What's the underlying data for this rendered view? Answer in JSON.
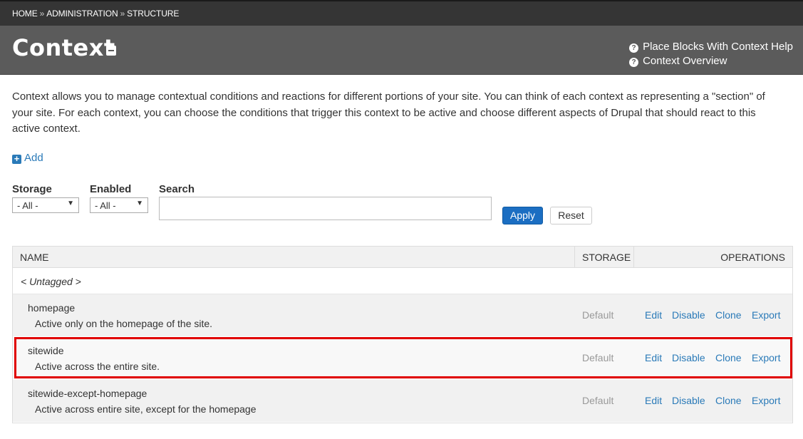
{
  "breadcrumb": {
    "items": [
      "HOME",
      "ADMINISTRATION",
      "STRUCTURE"
    ],
    "separator": "»"
  },
  "header": {
    "title": "Context",
    "help_links": [
      "Place Blocks With Context Help",
      "Context Overview"
    ]
  },
  "intro_text": "Context allows you to manage contextual conditions and reactions for different portions of your site. You can think of each context as representing a \"section\" of your site. For each context, you can choose the conditions that trigger this context to be active and choose different aspects of Drupal that should react to this active context.",
  "add_label": "Add",
  "filters": {
    "storage_label": "Storage",
    "storage_value": "- All -",
    "enabled_label": "Enabled",
    "enabled_value": "- All -",
    "search_label": "Search",
    "search_value": "",
    "apply_label": "Apply",
    "reset_label": "Reset"
  },
  "table": {
    "headers": {
      "name": "NAME",
      "storage": "STORAGE",
      "operations": "OPERATIONS"
    },
    "group_label": "< Untagged >",
    "rows": [
      {
        "name": "homepage",
        "description": "Active only on the homepage of the site.",
        "storage": "Default",
        "ops": [
          "Edit",
          "Disable",
          "Clone",
          "Export"
        ]
      },
      {
        "name": "sitewide",
        "description": "Active across the entire site.",
        "storage": "Default",
        "ops": [
          "Edit",
          "Disable",
          "Clone",
          "Export"
        ]
      },
      {
        "name": "sitewide-except-homepage",
        "description": "Active across entire site, except for the homepage",
        "storage": "Default",
        "ops": [
          "Edit",
          "Disable",
          "Clone",
          "Export"
        ]
      }
    ]
  },
  "colors": {
    "link": "#2a7ab8",
    "highlight": "#e00000",
    "header_bg": "#5b5b5b",
    "breadcrumb_bg": "#353535",
    "apply_bg": "#1b6ec2"
  }
}
